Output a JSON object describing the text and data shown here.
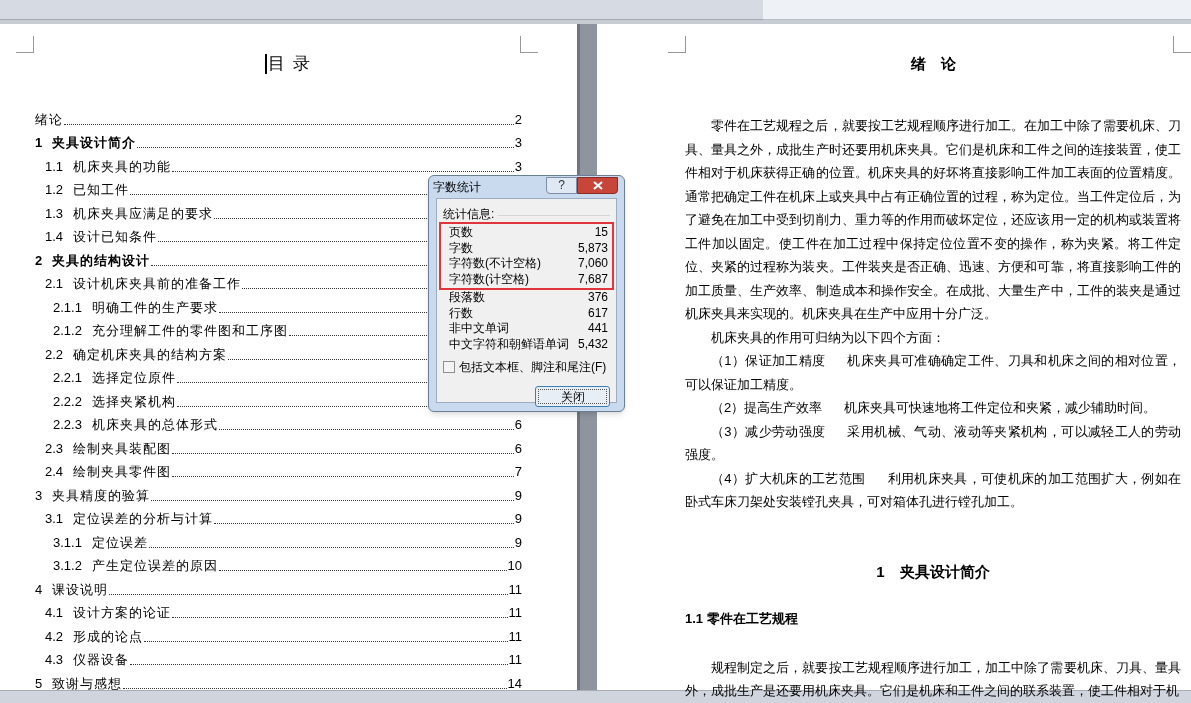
{
  "toc_page": {
    "title": "目 录",
    "entries": [
      {
        "title": "绪论",
        "page": "2",
        "bold": false
      },
      {
        "number": "1",
        "title": "夹具设计简介",
        "page": "3",
        "bold": true,
        "children": [
          {
            "number": "1.1",
            "title": "机床夹具的功能",
            "page": "3"
          },
          {
            "number": "1.2",
            "title": "已知工件"
          },
          {
            "number": "1.3",
            "title": "机床夹具应满足的要求"
          },
          {
            "number": "1.4",
            "title": "设计已知条件"
          }
        ]
      },
      {
        "number": "2",
        "title": "夹具的结构设计",
        "bold": true,
        "children": [
          {
            "number": "2.1",
            "title": "设计机床夹具前的准备工作",
            "children": [
              {
                "number": "2.1.1",
                "title": "明确工件的生产要求"
              },
              {
                "number": "2.1.2",
                "title": "充分理解工件的零件图和工序图"
              }
            ]
          },
          {
            "number": "2.2",
            "title": "确定机床夹具的结构方案",
            "children": [
              {
                "number": "2.2.1",
                "title": "选择定位原件"
              },
              {
                "number": "2.2.2",
                "title": "选择夹紧机构"
              },
              {
                "number": "2.2.3",
                "title": "机床夹具的总体形式",
                "page": "6"
              }
            ]
          },
          {
            "number": "2.3",
            "title": "绘制夹具装配图",
            "page": "6"
          },
          {
            "number": "2.4",
            "title": "绘制夹具零件图",
            "page": "7"
          }
        ]
      },
      {
        "number": "3",
        "title": "夹具精度的验算",
        "page": "9",
        "bold": false,
        "children": [
          {
            "number": "3.1",
            "title": "定位误差的分析与计算",
            "page": "9",
            "children": [
              {
                "number": "3.1.1",
                "title": "定位误差",
                "page": "9"
              },
              {
                "number": "3.1.2",
                "title": "产生定位误差的原因",
                "page": "10"
              }
            ]
          }
        ]
      },
      {
        "number": "4",
        "title": "课设说明",
        "page": "11",
        "bold": false,
        "children": [
          {
            "number": "4.1",
            "title": "设计方案的论证",
            "page": "11"
          },
          {
            "number": "4.2",
            "title": "形成的论点",
            "page": "11"
          },
          {
            "number": "4.3",
            "title": "仪器设备",
            "page": "11"
          }
        ]
      },
      {
        "number": "5",
        "title": "致谢与感想",
        "page": "14",
        "bold": false
      }
    ]
  },
  "body_page": {
    "blocks": [
      {
        "kind": "title",
        "text": "绪　论"
      },
      {
        "kind": "paragraph",
        "text": "零件在工艺规程之后，就要按工艺规程顺序进行加工。在加工中除了需要机床、刀具、量具之外，成批生产时还要用机床夹具。它们是机床和工件之间的连接装置，使工件相对于机床获得正确的位置。机床夹具的好坏将直接影响工件加工表面的位置精度。通常把确定工件在机床上或夹具中占有正确位置的过程，称为定位。当工件定位后，为了避免在加工中受到切削力、重力等的作用而破坏定位，还应该用一定的机构或装置将工件加以固定。使工件在加工过程中保持定位位置不变的操作，称为夹紧。将工件定位、夹紧的过程称为装夹。工件装夹是否正确、迅速、方便和可靠，将直接影响工件的加工质量、生产效率、制造成本和操作安全。在成批、大量生产中，工件的装夹是通过机床夹具来实现的。机床夹具在生产中应用十分广泛。"
      },
      {
        "kind": "paragraph",
        "text": "机床夹具的作用可归纳为以下四个方面："
      },
      {
        "kind": "item",
        "label": "（1）保证加工精度",
        "text": "机床夹具可准确确定工件、刀具和机床之间的相对位置，可以保证加工精度。"
      },
      {
        "kind": "item",
        "label": "（2）提高生产效率",
        "text": "机床夹具可快速地将工件定位和夹紧，减少辅助时间。"
      },
      {
        "kind": "item",
        "label": "（3）减少劳动强度",
        "text": "采用机械、气动、液动等夹紧机构，可以减轻工人的劳动强度。"
      },
      {
        "kind": "item",
        "label": "（4）扩大机床的工艺范围",
        "text": "利用机床夹具，可使机床的加工范围扩大，例如在卧式车床刀架处安装镗孔夹具，可对箱体孔进行镗孔加工。"
      },
      {
        "kind": "heading",
        "text": "1　夹具设计简介"
      },
      {
        "kind": "subheading",
        "text": "1.1 零件在工艺规程"
      },
      {
        "kind": "paragraph",
        "text": "规程制定之后，就要按工艺规程顺序进行加工，加工中除了需要机床、刀具、量具外，成批生产是还要用机床夹具。它们是机床和工件之间的联系装置，使工件相对于机"
      }
    ]
  },
  "dialog": {
    "title": "字数统计",
    "help": "?",
    "group": "统计信息:",
    "stats": [
      {
        "label": "页数",
        "value": "15",
        "highlighted": true
      },
      {
        "label": "字数",
        "value": "5,873",
        "highlighted": true
      },
      {
        "label": "字符数(不计空格)",
        "value": "7,060",
        "highlighted": true
      },
      {
        "label": "字符数(计空格)",
        "value": "7,687",
        "highlighted": true
      },
      {
        "label": "段落数",
        "value": "376",
        "highlighted": false
      },
      {
        "label": "行数",
        "value": "617",
        "highlighted": false
      },
      {
        "label": "非中文单词",
        "value": "441",
        "highlighted": false
      },
      {
        "label": "中文字符和朝鲜语单词",
        "value": "5,432",
        "highlighted": false
      }
    ],
    "checkbox": {
      "label": "包括文本框、脚注和尾注(F)",
      "checked": false
    },
    "button": "关闭"
  }
}
